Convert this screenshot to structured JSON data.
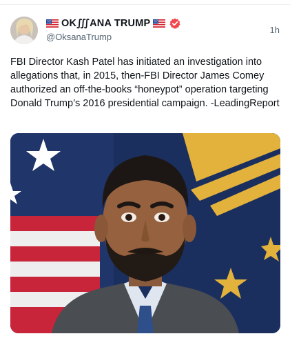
{
  "post": {
    "author": {
      "display_name": "OK∭ANA TRUMP",
      "handle": "@OksanaTrump",
      "verified_color": "#f0464e"
    },
    "timestamp": "1h",
    "text": "FBI Director Kash Patel has initiated an investigation into allegations that, in 2015, then-FBI Director James Comey authorized an off-the-books “honeypot” operation targeting Donald Trump’s 2016 presidential campaign. -LeadingReport",
    "media": {
      "icon": "portrait-photo"
    }
  },
  "colors": {
    "text": "#0f1419",
    "secondary_text": "#536471",
    "flag_blue": "#1b2f5e",
    "flag_gold": "#e3b23c"
  }
}
